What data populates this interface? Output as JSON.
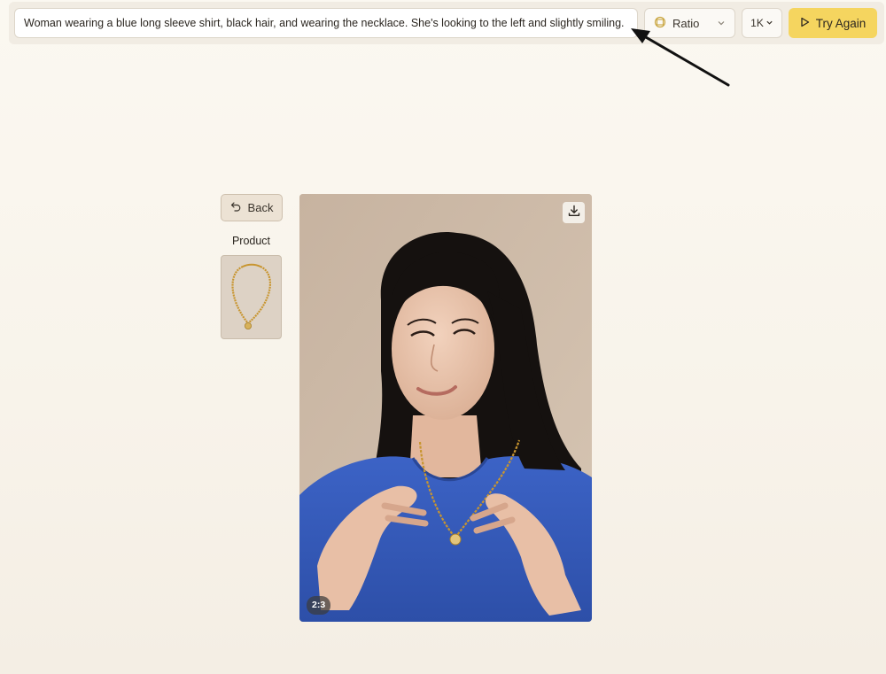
{
  "toolbar": {
    "prompt_value": "Woman wearing a blue long sleeve shirt, black hair, and wearing the necklace. She's looking to the left and slightly smiling. Her har",
    "ratio_label": "Ratio",
    "resolution_label": "1K",
    "try_again_label": "Try Again"
  },
  "sidebar": {
    "back_label": "Back",
    "product_label": "Product"
  },
  "result": {
    "ratio_badge": "2:3"
  },
  "colors": {
    "accent": "#f5d55f",
    "background": "#fbf8f1",
    "shirt": "#3b5fbf"
  },
  "icons": [
    "ratio-icon",
    "chevron-down-icon",
    "play-icon",
    "undo-arrow-icon",
    "download-icon",
    "necklace-icon"
  ]
}
